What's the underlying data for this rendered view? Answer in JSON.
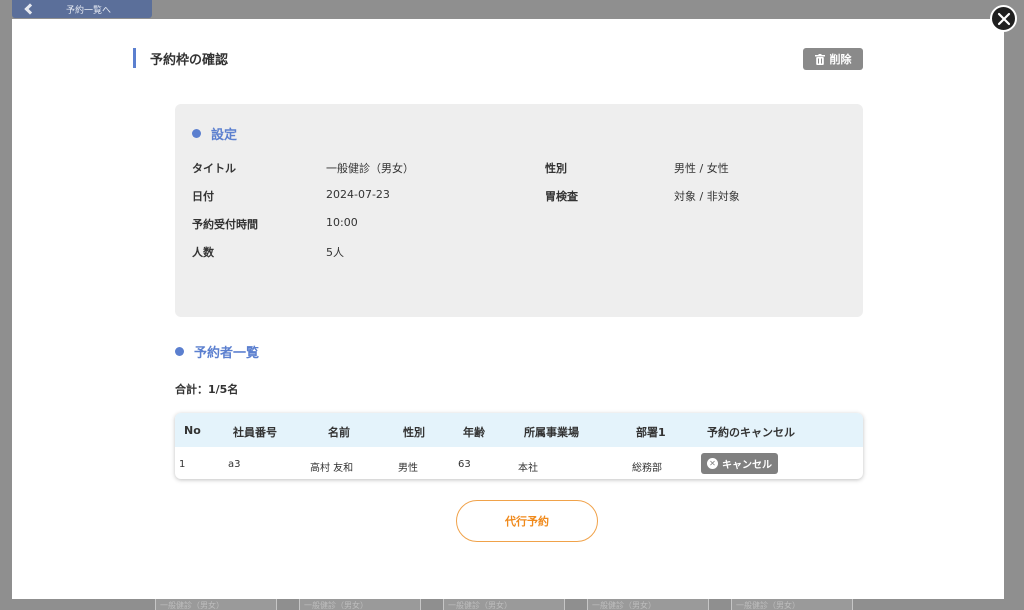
{
  "background": {
    "back_label": "予約一覧へ",
    "card_label": "一般健診（男女）"
  },
  "modal": {
    "title": "予約枠の確認",
    "delete_label": "削除",
    "settings": {
      "heading": "設定",
      "fields": {
        "title_label": "タイトル",
        "title_value": "一般健診（男女）",
        "date_label": "日付",
        "date_value": "2024-07-23",
        "time_label": "予約受付時間",
        "time_value": "10:00",
        "count_label": "人数",
        "count_value": "5人",
        "gender_label": "性別",
        "gender_value": "男性 / 女性",
        "stomach_label": "胃検査",
        "stomach_value": "対象 / 非対象"
      }
    },
    "reservations": {
      "heading": "予約者一覧",
      "total": "合計：1/5名",
      "columns": [
        "No",
        "社員番号",
        "名前",
        "性別",
        "年齢",
        "所属事業場",
        "部署1",
        "予約のキャンセル"
      ],
      "rows": [
        {
          "no": "1",
          "employee_no": "a3",
          "name": "高村 友和",
          "gender": "男性",
          "age": "63",
          "office": "本社",
          "dept": "総務部",
          "cancel_label": "キャンセル"
        }
      ]
    },
    "proxy_label": "代行予約"
  },
  "colors": {
    "accent": "#5b7fcf",
    "orange": "#f08a1c",
    "header_bg": "#e4f3fb",
    "panel_bg": "#eeeeee"
  }
}
